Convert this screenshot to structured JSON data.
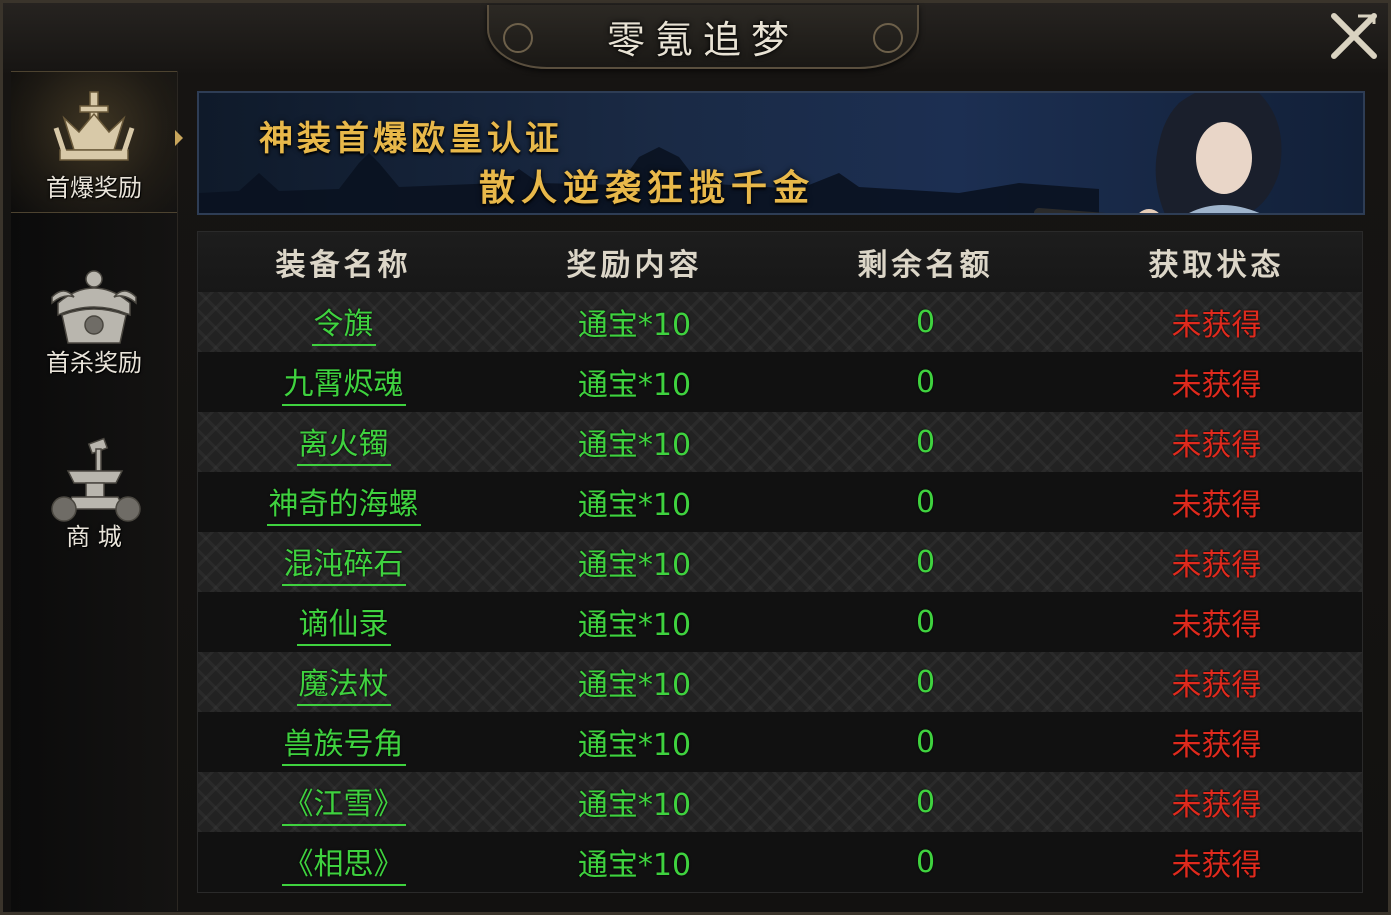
{
  "window": {
    "title": "零氪追梦"
  },
  "sidebar": {
    "items": [
      {
        "label": "首爆奖励",
        "icon": "sword-crown-icon",
        "active": true
      },
      {
        "label": "首杀奖励",
        "icon": "helmet-icon",
        "active": false
      },
      {
        "label": "商 城",
        "icon": "anvil-icon",
        "active": false
      }
    ]
  },
  "banner": {
    "line1": "神装首爆欧皇认证",
    "line2": "散人逆袭狂揽千金"
  },
  "table": {
    "headers": [
      "装备名称",
      "奖励内容",
      "剩余名额",
      "获取状态"
    ],
    "rows": [
      {
        "name": "令旗",
        "reward": "通宝*10",
        "remaining": "0",
        "status": "未获得"
      },
      {
        "name": "九霄烬魂",
        "reward": "通宝*10",
        "remaining": "0",
        "status": "未获得"
      },
      {
        "name": "离火镯",
        "reward": "通宝*10",
        "remaining": "0",
        "status": "未获得"
      },
      {
        "name": "神奇的海螺",
        "reward": "通宝*10",
        "remaining": "0",
        "status": "未获得"
      },
      {
        "name": "混沌碎石",
        "reward": "通宝*10",
        "remaining": "0",
        "status": "未获得"
      },
      {
        "name": "谪仙录",
        "reward": "通宝*10",
        "remaining": "0",
        "status": "未获得"
      },
      {
        "name": "魔法杖",
        "reward": "通宝*10",
        "remaining": "0",
        "status": "未获得"
      },
      {
        "name": "兽族号角",
        "reward": "通宝*10",
        "remaining": "0",
        "status": "未获得"
      },
      {
        "name": "《江雪》",
        "reward": "通宝*10",
        "remaining": "0",
        "status": "未获得"
      },
      {
        "name": "《相思》",
        "reward": "通宝*10",
        "remaining": "0",
        "status": "未获得"
      }
    ]
  },
  "colors": {
    "name_green": "#3fd23f",
    "status_red": "#e02a1d",
    "banner_gold": "#e8b84a"
  }
}
